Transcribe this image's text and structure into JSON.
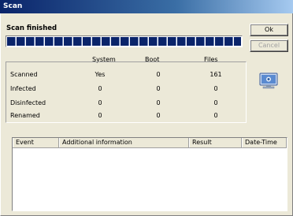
{
  "window": {
    "title": "Scan"
  },
  "status": {
    "text": "Scan finished"
  },
  "progress": {
    "fraction": 1.0
  },
  "buttons": {
    "ok": "Ok",
    "cancel": "Cancel"
  },
  "stats": {
    "columns": [
      "System",
      "Boot",
      "Files"
    ],
    "rows": [
      {
        "label": "Scanned",
        "values": [
          "Yes",
          "0",
          "161"
        ]
      },
      {
        "label": "Infected",
        "values": [
          "0",
          "0",
          "0"
        ]
      },
      {
        "label": "Disinfected",
        "values": [
          "0",
          "0",
          "0"
        ]
      },
      {
        "label": "Renamed",
        "values": [
          "0",
          "0",
          "0"
        ]
      }
    ]
  },
  "results": {
    "columns": [
      "Event",
      "Additional information",
      "Result",
      "Date-Time"
    ]
  },
  "icons": {
    "monitor": "monitor-icon"
  }
}
